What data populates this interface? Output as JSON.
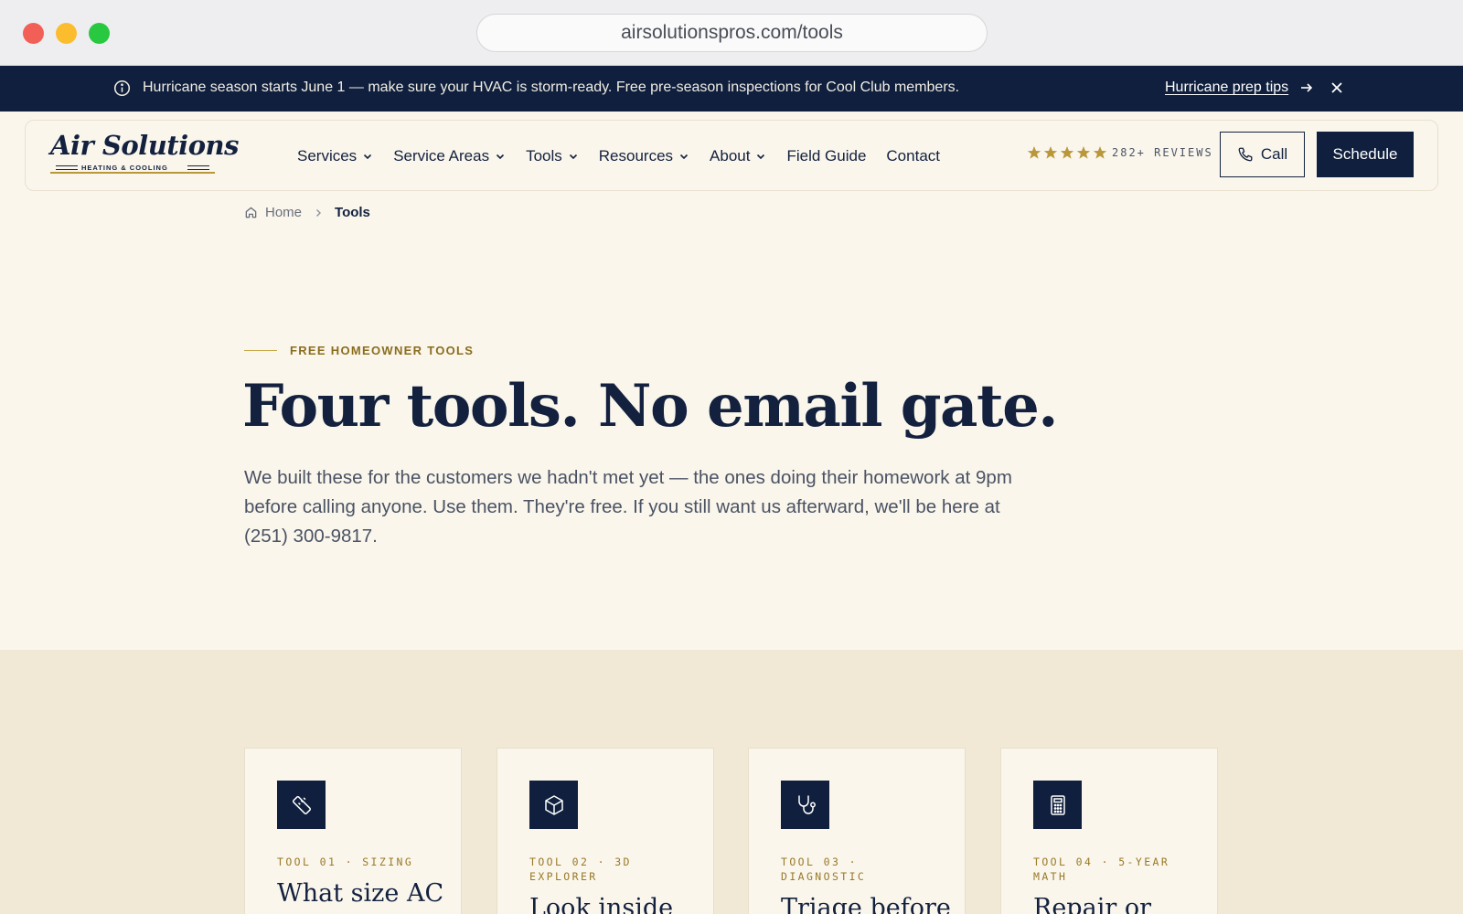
{
  "browser": {
    "url": "airsolutionspros.com/tools"
  },
  "announcement": {
    "message": "Hurricane season starts June 1 — make sure your HVAC is storm-ready. Free pre-season inspections for Cool Club members.",
    "link_label": "Hurricane prep tips",
    "info_icon": "info-icon",
    "close_icon": "close-icon"
  },
  "brand": {
    "logo_text": "Air Solutions",
    "logo_subtext": "HEATING & COOLING",
    "accent_gold": "#b9983c",
    "navy": "#0f1f3d"
  },
  "nav": {
    "items": [
      {
        "label": "Services",
        "dropdown": true
      },
      {
        "label": "Service Areas",
        "dropdown": true
      },
      {
        "label": "Tools",
        "dropdown": true
      },
      {
        "label": "Resources",
        "dropdown": true
      },
      {
        "label": "About",
        "dropdown": true
      },
      {
        "label": "Field Guide",
        "dropdown": false
      },
      {
        "label": "Contact",
        "dropdown": false
      }
    ],
    "rating_stars": 5,
    "reviews_label": "282+ REVIEWS",
    "call_label": "Call",
    "schedule_label": "Schedule"
  },
  "breadcrumb": {
    "home": "Home",
    "current": "Tools"
  },
  "hero": {
    "eyebrow": "FREE HOMEOWNER TOOLS",
    "headline": "Four tools. No email gate.",
    "lede": "We built these for the customers we hadn't met yet — the ones doing their homework at 9pm before calling anyone. Use them. They're free. If you still want us afterward, we'll be here at (251) 300-9817."
  },
  "tools": [
    {
      "icon": "ruler-icon",
      "tag": "TOOL 01 · SIZING",
      "title": "What size AC"
    },
    {
      "icon": "cube-icon",
      "tag": "TOOL 02 · 3D EXPLORER",
      "title": "Look inside"
    },
    {
      "icon": "stethoscope-icon",
      "tag": "TOOL 03 · DIAGNOSTIC",
      "title": "Triage before"
    },
    {
      "icon": "calculator-icon",
      "tag": "TOOL 04 · 5-YEAR MATH",
      "title": "Repair or"
    }
  ]
}
